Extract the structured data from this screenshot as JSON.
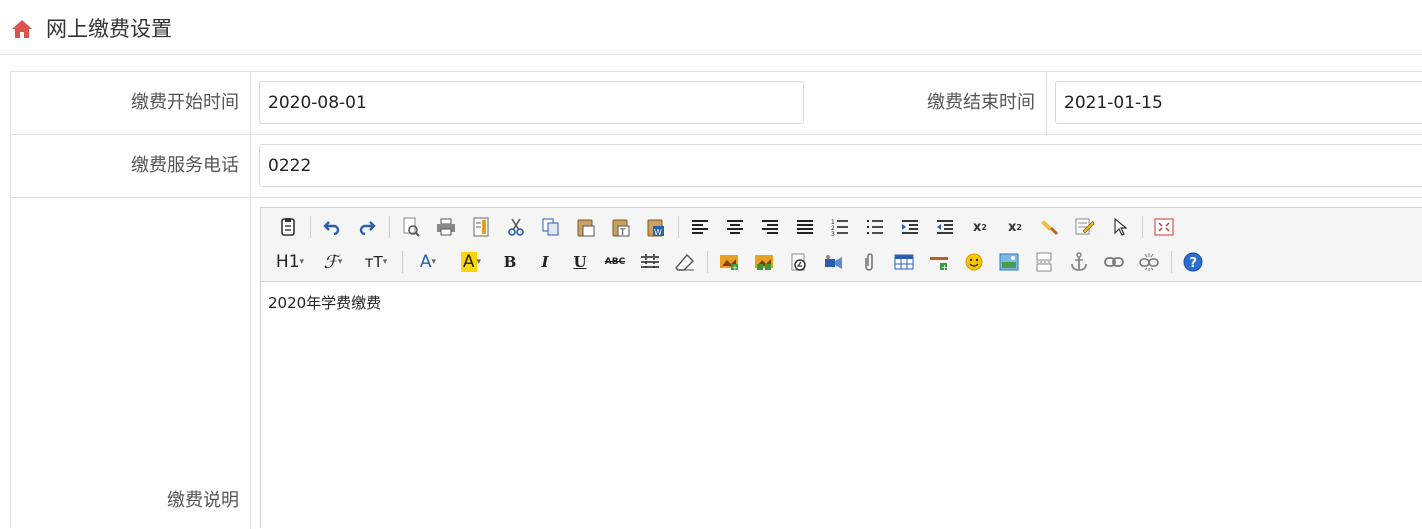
{
  "header": {
    "title": "网上缴费设置",
    "icon": "home-icon"
  },
  "form": {
    "start_time": {
      "label": "缴费开始时间",
      "value": "2020-08-01"
    },
    "end_time": {
      "label": "缴费结束时间",
      "value": "2021-01-15"
    },
    "phone": {
      "label": "缴费服务电话",
      "value": "0222"
    },
    "description": {
      "label": "缴费说明",
      "content": "2020年学费缴费"
    }
  },
  "editor_toolbar": {
    "row1": [
      "source-code-icon",
      "undo-icon",
      "redo-icon",
      "preview-icon",
      "print-icon",
      "template-icon",
      "cut-icon",
      "copy-icon",
      "paste-icon",
      "paste-text-icon",
      "paste-word-icon",
      "align-left-icon",
      "align-center-icon",
      "align-right-icon",
      "align-justify-icon",
      "ordered-list-icon",
      "unordered-list-icon",
      "indent-icon",
      "outdent-icon",
      "subscript-icon",
      "superscript-icon",
      "clear-format-icon",
      "select-all-icon",
      "select-cursor-icon",
      "fullscreen-icon"
    ],
    "row2": [
      "heading-icon",
      "font-family-icon",
      "font-size-icon",
      "font-color-icon",
      "highlight-color-icon",
      "bold-icon",
      "italic-icon",
      "underline-icon",
      "strikethrough-icon",
      "line-height-icon",
      "eraser-icon",
      "image-icon",
      "multi-image-icon",
      "flash-icon",
      "media-icon",
      "attachment-icon",
      "table-icon",
      "horizontal-rule-icon",
      "emoticon-icon",
      "map-icon",
      "page-break-icon",
      "anchor-icon",
      "link-icon",
      "unlink-icon",
      "help-icon"
    ],
    "heading_label": "H1",
    "font_size_label": "тT"
  },
  "colors": {
    "accent": "#d9534f",
    "border": "#e2e2e2",
    "toolbar_bg": "#f5f5f5"
  }
}
